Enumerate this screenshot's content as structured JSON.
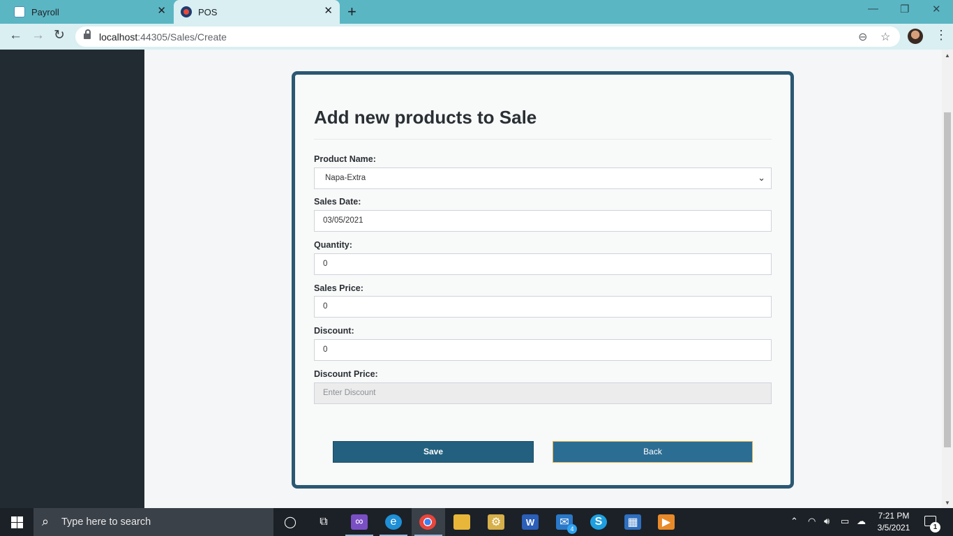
{
  "browser": {
    "tabs": [
      {
        "label": "Payroll"
      },
      {
        "label": "POS"
      }
    ],
    "url_host": "localhost",
    "url_rest": ":44305/Sales/Create"
  },
  "form": {
    "title": "Add new products to Sale",
    "product_name": {
      "label": "Product Name:",
      "value": "Napa-Extra"
    },
    "sales_date": {
      "label": "Sales Date:",
      "value": "03/05/2021"
    },
    "quantity": {
      "label": "Quantity:",
      "value": "0"
    },
    "sales_price": {
      "label": "Sales Price:",
      "value": "0"
    },
    "discount": {
      "label": "Discount:",
      "value": "0"
    },
    "discount_price": {
      "label": "Discount Price:",
      "placeholder": "Enter Discount"
    },
    "save_label": "Save",
    "back_label": "Back"
  },
  "taskbar": {
    "search_placeholder": "Type here to search",
    "time": "7:21 PM",
    "date": "3/5/2021",
    "mail_badge": "4",
    "notification_count": "1"
  },
  "colors": {
    "tab_strip": "#5bb6c4",
    "sidebar": "#222b32",
    "card_border": "#2b5873",
    "save_button": "#23607f",
    "back_button": "#2c6d93"
  }
}
